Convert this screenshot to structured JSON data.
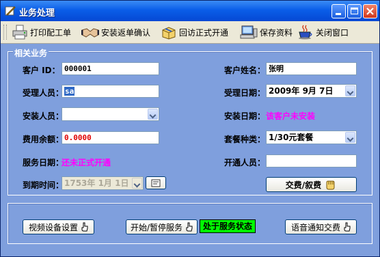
{
  "window": {
    "title": "业务处理"
  },
  "toolbar": [
    {
      "label": "打印配工单",
      "icon": "printer-icon"
    },
    {
      "label": "安装返单确认",
      "icon": "handshake-icon"
    },
    {
      "label": "回访正式开通",
      "icon": "gift-box-icon"
    },
    {
      "label": "保存资料",
      "icon": "computer-save-icon"
    },
    {
      "label": "关闭窗口",
      "icon": "coffee-cup-icon"
    }
  ],
  "group1": {
    "legend": "相关业务",
    "customer_id": {
      "label": "客户 ID：",
      "value": "000001"
    },
    "customer_name": {
      "label": "客户姓名：",
      "value": "张明"
    },
    "handler": {
      "label": "受理人员：",
      "value": "sa"
    },
    "accept_date": {
      "label": "受理日期：",
      "value": "2009年  9月  7日"
    },
    "installer": {
      "label": "安装人员：",
      "value": ""
    },
    "install_date": {
      "label": "安装日期：",
      "value": "该客户未安装"
    },
    "balance": {
      "label": "费用余额：",
      "value": "0.0000"
    },
    "package": {
      "label": "套餐种类：",
      "value": "1/30元套餐"
    },
    "service_date": {
      "label": "服务日期：",
      "value": "还未正式开通"
    },
    "activator": {
      "label": "开通人员：",
      "value": ""
    },
    "expire": {
      "label": "到期时间：",
      "value": "1753年  1月  1日"
    },
    "pay_button": "交费/叙费"
  },
  "group2": {
    "video_button": "视频设备设置",
    "service_toggle_button": "开始/暂停服务",
    "service_status": "处于服务状态",
    "voice_button": "语音通知交费"
  },
  "colors": {
    "form_bg": "#7f9fdd",
    "highlight_text": "#ff00ff",
    "status_bg": "#00ff00",
    "titlebar": "#0a5ee8"
  }
}
